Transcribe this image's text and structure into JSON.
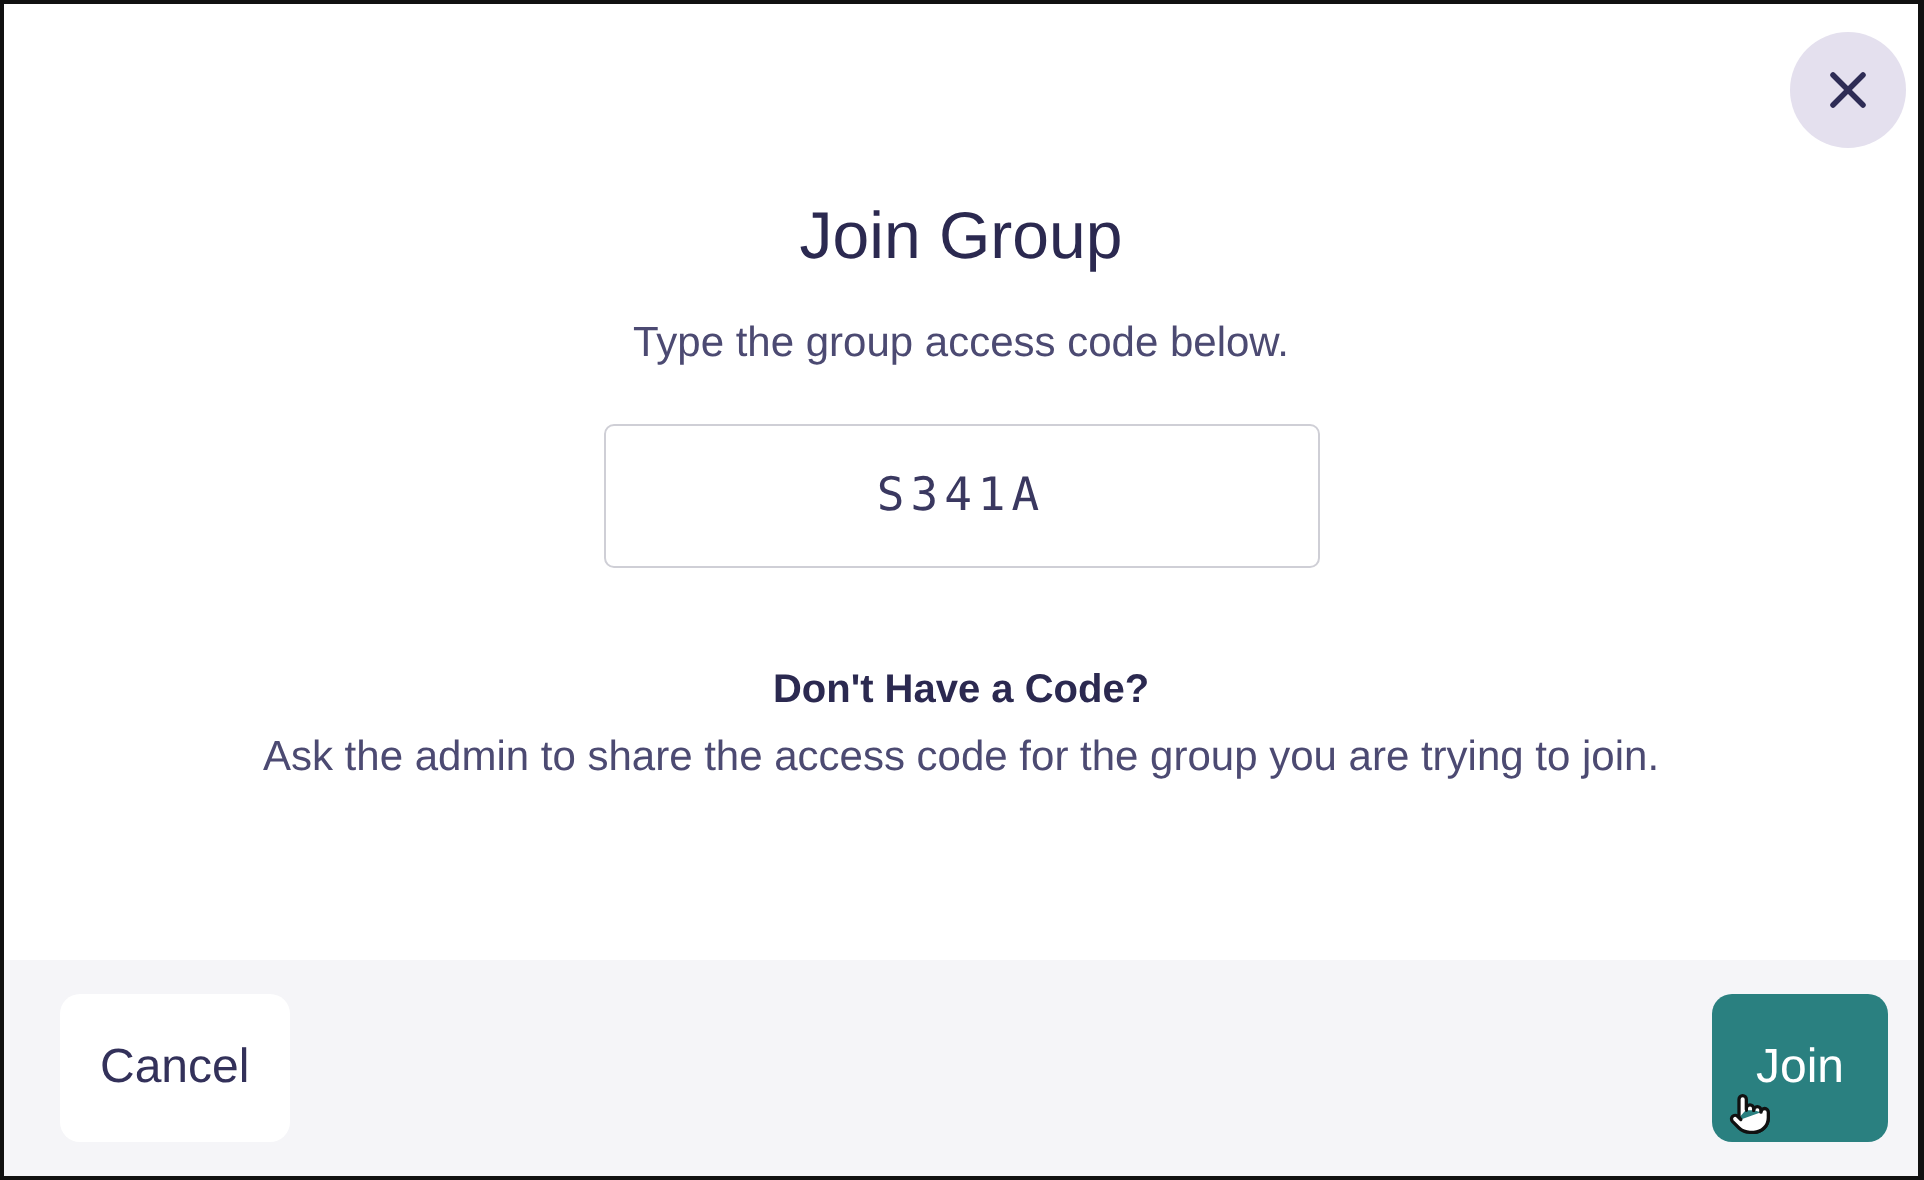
{
  "dialog": {
    "title": "Join Group",
    "subtitle": "Type the group access code below.",
    "code_field": {
      "value": "S341A"
    },
    "help": {
      "heading": "Don't Have a Code?",
      "text": "Ask the admin to share the access code for the group you are trying to join."
    }
  },
  "footer": {
    "buttons": [
      {
        "label": "Cancel",
        "kind": "secondary"
      },
      {
        "label": "Join",
        "kind": "primary"
      }
    ]
  }
}
